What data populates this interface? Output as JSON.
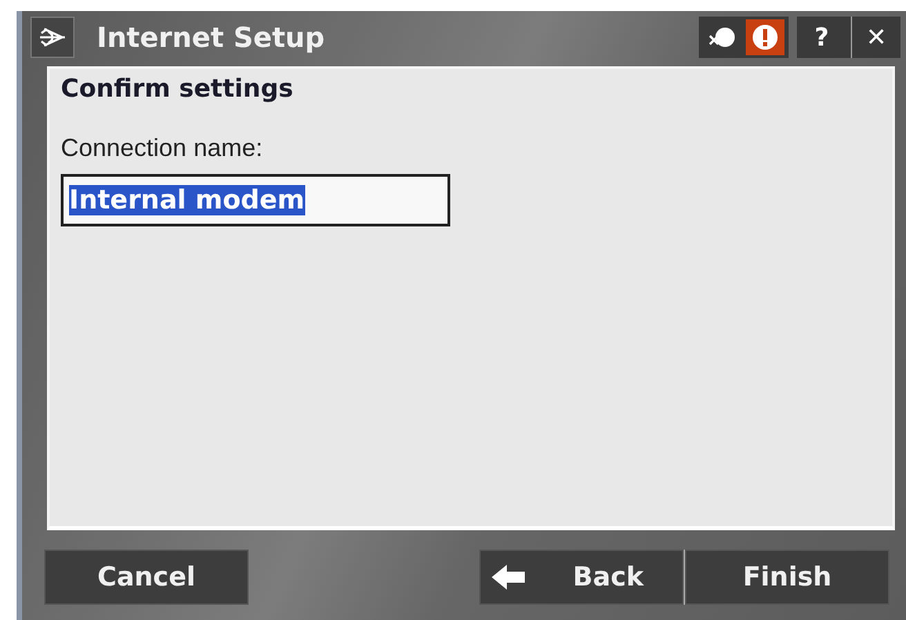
{
  "window": {
    "title": "Internet Setup",
    "help": "?",
    "close": "✕"
  },
  "page": {
    "heading": "Confirm settings",
    "field_label": "Connection name:"
  },
  "connection_field": {
    "value": "Internal modem",
    "text_selected": true
  },
  "buttons": [
    {
      "label": "Cancel",
      "kind": "plain"
    },
    {
      "label": "Back",
      "kind": "back"
    },
    {
      "label": "Finish",
      "kind": "plain"
    }
  ]
}
